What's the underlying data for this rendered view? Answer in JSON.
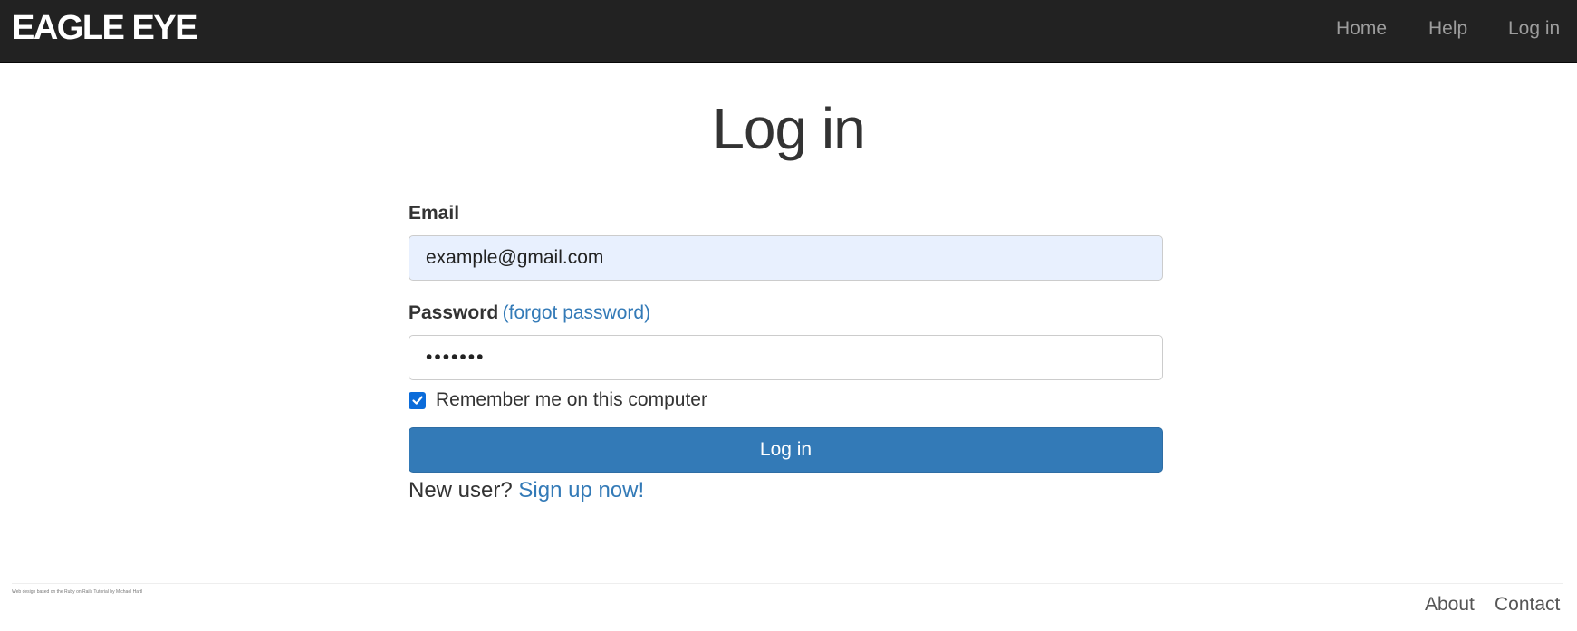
{
  "header": {
    "brand": "EAGLE EYE",
    "nav": {
      "home": "Home",
      "help": "Help",
      "login": "Log in"
    }
  },
  "main": {
    "title": "Log in",
    "email_label": "Email",
    "email_value": "example@gmail.com",
    "password_label": "Password",
    "forgot_link": "(forgot password)",
    "password_value": "•••••••",
    "remember_checked": true,
    "remember_label": "Remember me on this computer",
    "submit_label": "Log in",
    "new_user_text": "New user?",
    "signup_link": "Sign up now!"
  },
  "footer": {
    "credit": "Web design based on the Ruby on Rails Tutorial by Michael Hartl",
    "about": "About",
    "contact": "Contact"
  },
  "colors": {
    "navbar_bg": "#222222",
    "link": "#337ab7",
    "primary_button": "#337ab7",
    "autofill_bg": "#e8f0fe",
    "checkbox": "#0b6cda"
  },
  "icons": {
    "checkbox": "checkmark-icon"
  }
}
